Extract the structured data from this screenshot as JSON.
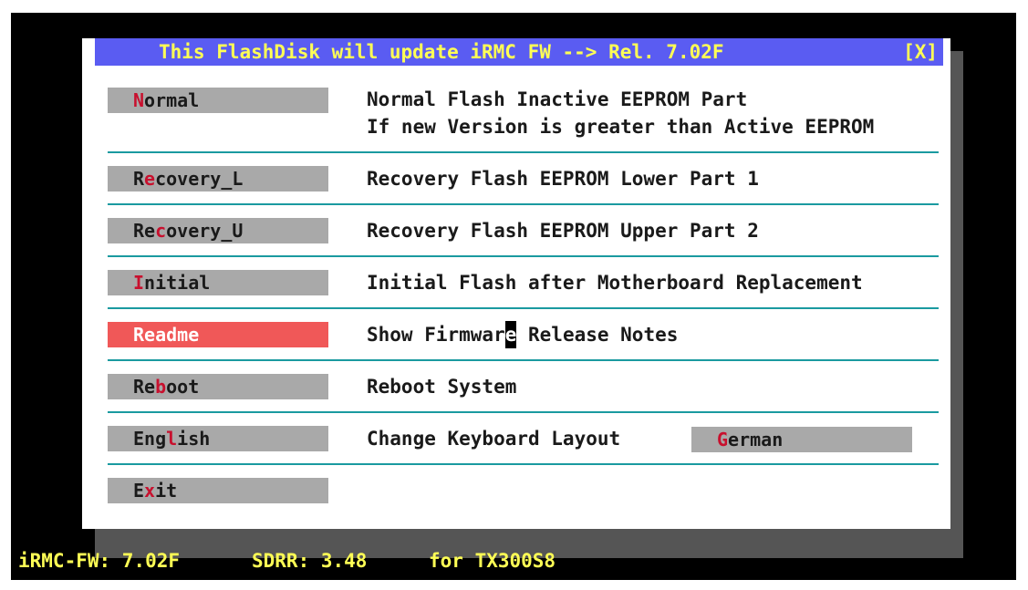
{
  "dialog": {
    "title": "This FlashDisk will update iRMC FW --> Rel. 7.02F",
    "close_label": "[X]"
  },
  "menu": [
    {
      "hotkey_before": "",
      "hotkey": "N",
      "hotkey_after": "ormal",
      "desc1": "Normal Flash Inactive EEPROM Part",
      "desc2": "If new Version is greater than Active EEPROM"
    },
    {
      "hotkey_before": "R",
      "hotkey": "e",
      "hotkey_after": "covery_L",
      "desc1": "Recovery Flash EEPROM Lower Part 1"
    },
    {
      "hotkey_before": "Re",
      "hotkey": "c",
      "hotkey_after": "overy_U",
      "desc1": "Recovery Flash EEPROM Upper Part 2"
    },
    {
      "hotkey_before": "",
      "hotkey": "I",
      "hotkey_after": "nitial",
      "desc1": "Initial Flash after Motherboard Replacement"
    },
    {
      "label": "Readme",
      "desc_before": "Show Firmwar",
      "desc_cursor": "e",
      "desc_after": " Release Notes"
    },
    {
      "hotkey_before": "Re",
      "hotkey": "b",
      "hotkey_after": "oot",
      "desc1": "Reboot System"
    },
    {
      "hotkey_before": "Eng",
      "hotkey": "l",
      "hotkey_after": "ish",
      "desc1": "Change Keyboard Layout"
    },
    {
      "hotkey_before": "E",
      "hotkey": "x",
      "hotkey_after": "it"
    }
  ],
  "german_button": {
    "hotkey_before": "",
    "hotkey": "G",
    "hotkey_after": "erman"
  },
  "status": {
    "firmware": "iRMC-FW: 7.02F",
    "sdrr": "SDRR: 3.48",
    "target": "for TX300S8"
  },
  "colors": {
    "title_bar": "#5a5cf2",
    "title_text": "#ffff55",
    "button": "#a9a9a9",
    "button_active": "#f05858",
    "hotkey": "#c8102e",
    "separator": "#1a9aa0"
  }
}
